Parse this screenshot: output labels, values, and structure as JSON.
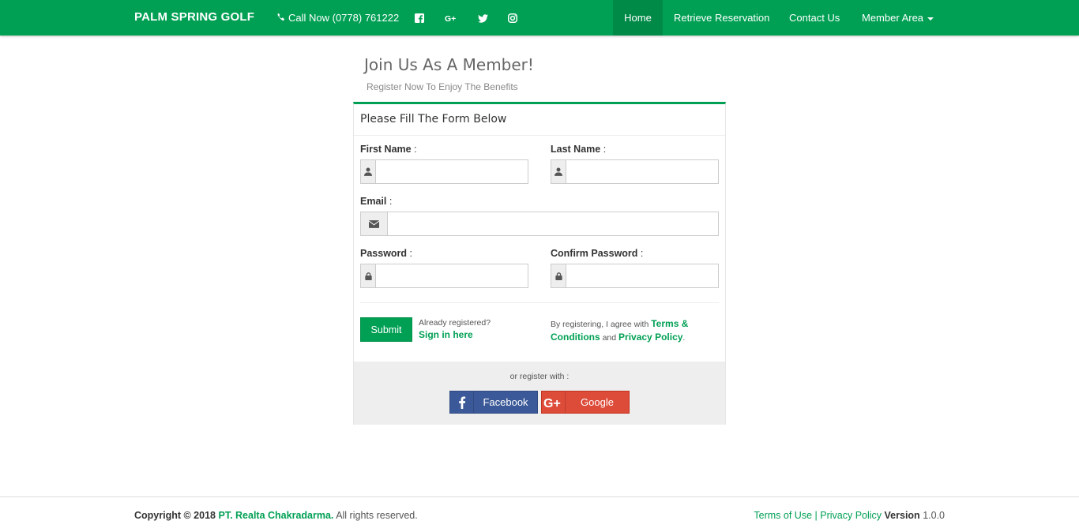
{
  "brand": "PALM SPRING GOLF",
  "call_now": "Call Now (0778) 761222",
  "nav": {
    "home": "Home",
    "retrieve": "Retrieve Reservation",
    "contact": "Contact Us",
    "member": "Member Area"
  },
  "header": {
    "title": "Join Us As A Member!",
    "subtitle": "Register Now To Enjoy The Benefits"
  },
  "form": {
    "heading": "Please Fill The Form Below",
    "first_name_label": "First Name",
    "last_name_label": "Last Name",
    "email_label": "Email",
    "password_label": "Password",
    "confirm_password_label": "Confirm Password",
    "colon": " :",
    "submit": "Submit",
    "already_registered": "Already registered?",
    "sign_in": "Sign in here",
    "agree_prefix": "By registering, I agree with",
    "terms": "Terms & Conditions",
    "and": "and",
    "privacy": "Privacy Policy",
    "period": "."
  },
  "social_register": {
    "or_text": "or register with :",
    "facebook": "Facebook",
    "google": "Google"
  },
  "footer": {
    "copyright_prefix": "Copyright © 2018",
    "company": "PT. Realta Chakradarma.",
    "rights": "All rights reserved.",
    "terms_of_use": "Terms of Use",
    "separator": "|",
    "privacy_policy": "Privacy Policy",
    "version_label": "Version",
    "version": "1.0.0"
  },
  "colors": {
    "primary": "#00a054",
    "facebook": "#3b5998",
    "google": "#dd4b39"
  }
}
